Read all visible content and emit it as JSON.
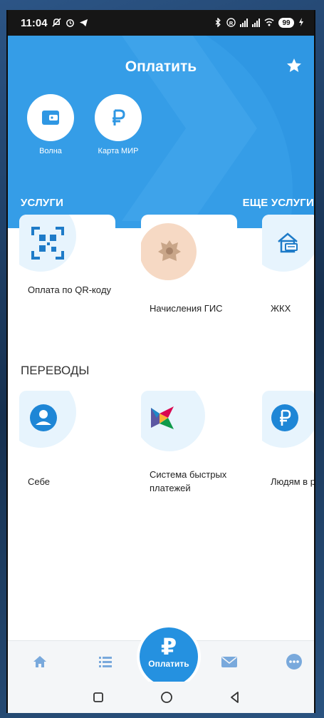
{
  "status_bar": {
    "time": "11:04",
    "battery": "99"
  },
  "header": {
    "title": "Оплатить"
  },
  "quick_actions": [
    {
      "label": "Волна",
      "icon": "wallet-icon"
    },
    {
      "label": "Карта МИР",
      "icon": "ruble-icon"
    }
  ],
  "services": {
    "title": "УСЛУГИ",
    "more_link": "ЕЩЕ УСЛУГИ",
    "items": [
      {
        "label": "Оплата по QR-кoду",
        "icon": "qr-code-icon"
      },
      {
        "label": "Начисления ГИС",
        "icon": "coat-of-arms-icon"
      },
      {
        "label": "ЖКХ",
        "icon": "house-bill-icon"
      }
    ]
  },
  "transfers": {
    "title": "ПЕРЕВОДЫ",
    "items": [
      {
        "label": "Себе",
        "icon": "user-icon"
      },
      {
        "label": "Система быстрых платежей",
        "icon": "sbp-logo-icon"
      },
      {
        "label": "Людям в ру",
        "icon": "ruble-icon"
      }
    ]
  },
  "bottom_nav": {
    "pay_label": "Оплатить",
    "pay_symbol": "₽",
    "items": [
      "home-icon",
      "list-icon",
      "mail-icon",
      "more-icon"
    ]
  },
  "colors": {
    "primary": "#2f97e3",
    "accent": "#2591e0"
  }
}
